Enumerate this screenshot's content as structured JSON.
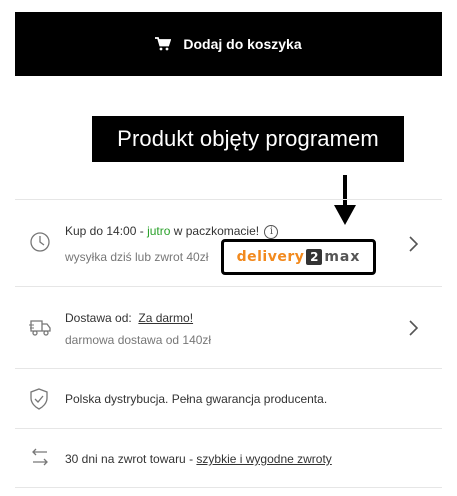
{
  "cart_button": {
    "label": "Dodaj do koszyka",
    "icon": "cart-icon"
  },
  "promo": {
    "banner_text": "Produkt objęty programem"
  },
  "delivery_time": {
    "title_prefix": "Kup do 14:00 - ",
    "title_highlight": "jutro",
    "title_suffix": " w paczkomacie!",
    "info_glyph": "i",
    "subtitle": "wysyłka dziś lub zwrot 40zł",
    "highlight_color": "#2aa12a",
    "icon": "clock-icon"
  },
  "partner_logo": {
    "part1": "delivery",
    "part2": "2",
    "part3": "max",
    "brand_color": "#f28a1e"
  },
  "shipping": {
    "label": "Dostawa od:",
    "link": "Za darmo!",
    "subtitle": "darmowa dostawa od 140zł",
    "icon": "truck-icon"
  },
  "distribution": {
    "text": "Polska dystrybucja. Pełna gwarancja producenta.",
    "icon": "shield-icon"
  },
  "returns": {
    "text_prefix": "30 dni na zwrot towaru - ",
    "link": "szybkie i wygodne zwroty",
    "icon": "return-arrow-icon"
  }
}
